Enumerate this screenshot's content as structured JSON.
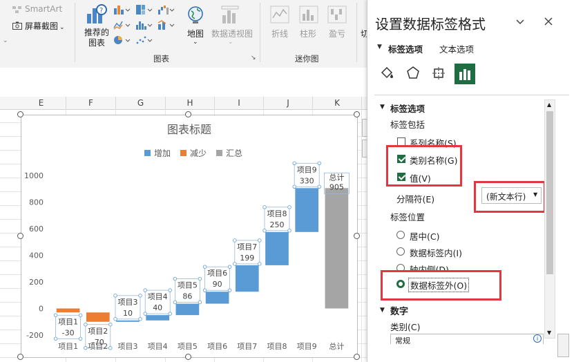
{
  "ribbon": {
    "smartart": "SmartArt",
    "screenshot": "屏幕截图",
    "recommended_line1": "推荐的",
    "recommended_line2": "图表",
    "map": "地图",
    "pivotchart": "数据透视图",
    "sparkline_line": "折线",
    "sparkline_column": "柱形",
    "sparkline_winloss": "盈亏",
    "slicer_partial": "切",
    "group_charts": "图表",
    "group_sparklines": "迷你图"
  },
  "columns": [
    "E",
    "F",
    "G",
    "H",
    "I",
    "J",
    "K"
  ],
  "chart": {
    "title": "图表标题",
    "legend": [
      {
        "name": "增加",
        "color": "#5b9bd5"
      },
      {
        "name": "减少",
        "color": "#ed7d31"
      },
      {
        "name": "汇总",
        "color": "#a5a5a5"
      }
    ],
    "yticks": [
      "1000",
      "800",
      "600",
      "400",
      "200",
      "0",
      "-200"
    ]
  },
  "chart_data": {
    "type": "bar",
    "title": "图表标题",
    "categories": [
      "项目1",
      "项目2",
      "项目3",
      "项目4",
      "项目5",
      "项目6",
      "项目7",
      "项目8",
      "项目9",
      "总计"
    ],
    "values": [
      -30,
      -70,
      10,
      40,
      86,
      90,
      199,
      250,
      330,
      905
    ],
    "series": [
      {
        "name": "增加",
        "color": "#5b9bd5"
      },
      {
        "name": "减少",
        "color": "#ed7d31"
      },
      {
        "name": "汇总",
        "color": "#a5a5a5"
      }
    ],
    "waterfall": true,
    "ylim": [
      -200,
      1000
    ],
    "ytick_step": 200,
    "legend_position": "top",
    "grid": false
  },
  "panel": {
    "title": "设置数据标签格式",
    "tab_label_options": "标签选项",
    "tab_text_options": "文本选项",
    "section_label_options": "标签选项",
    "label_contains": "标签包括",
    "series_name": "系列名称(S)",
    "category_name": "类别名称(G)",
    "value": "值(V)",
    "separator_label": "分隔符(E)",
    "separator_value": "(新文本行)",
    "label_position": "标签位置",
    "pos_center": "居中(C)",
    "pos_inside_end": "数据标签内(I)",
    "pos_inside_base": "轴内侧(D)",
    "pos_outside_end": "数据标签外(O)",
    "section_number": "数字",
    "category_label": "类别(C)",
    "category_value": "常规"
  }
}
